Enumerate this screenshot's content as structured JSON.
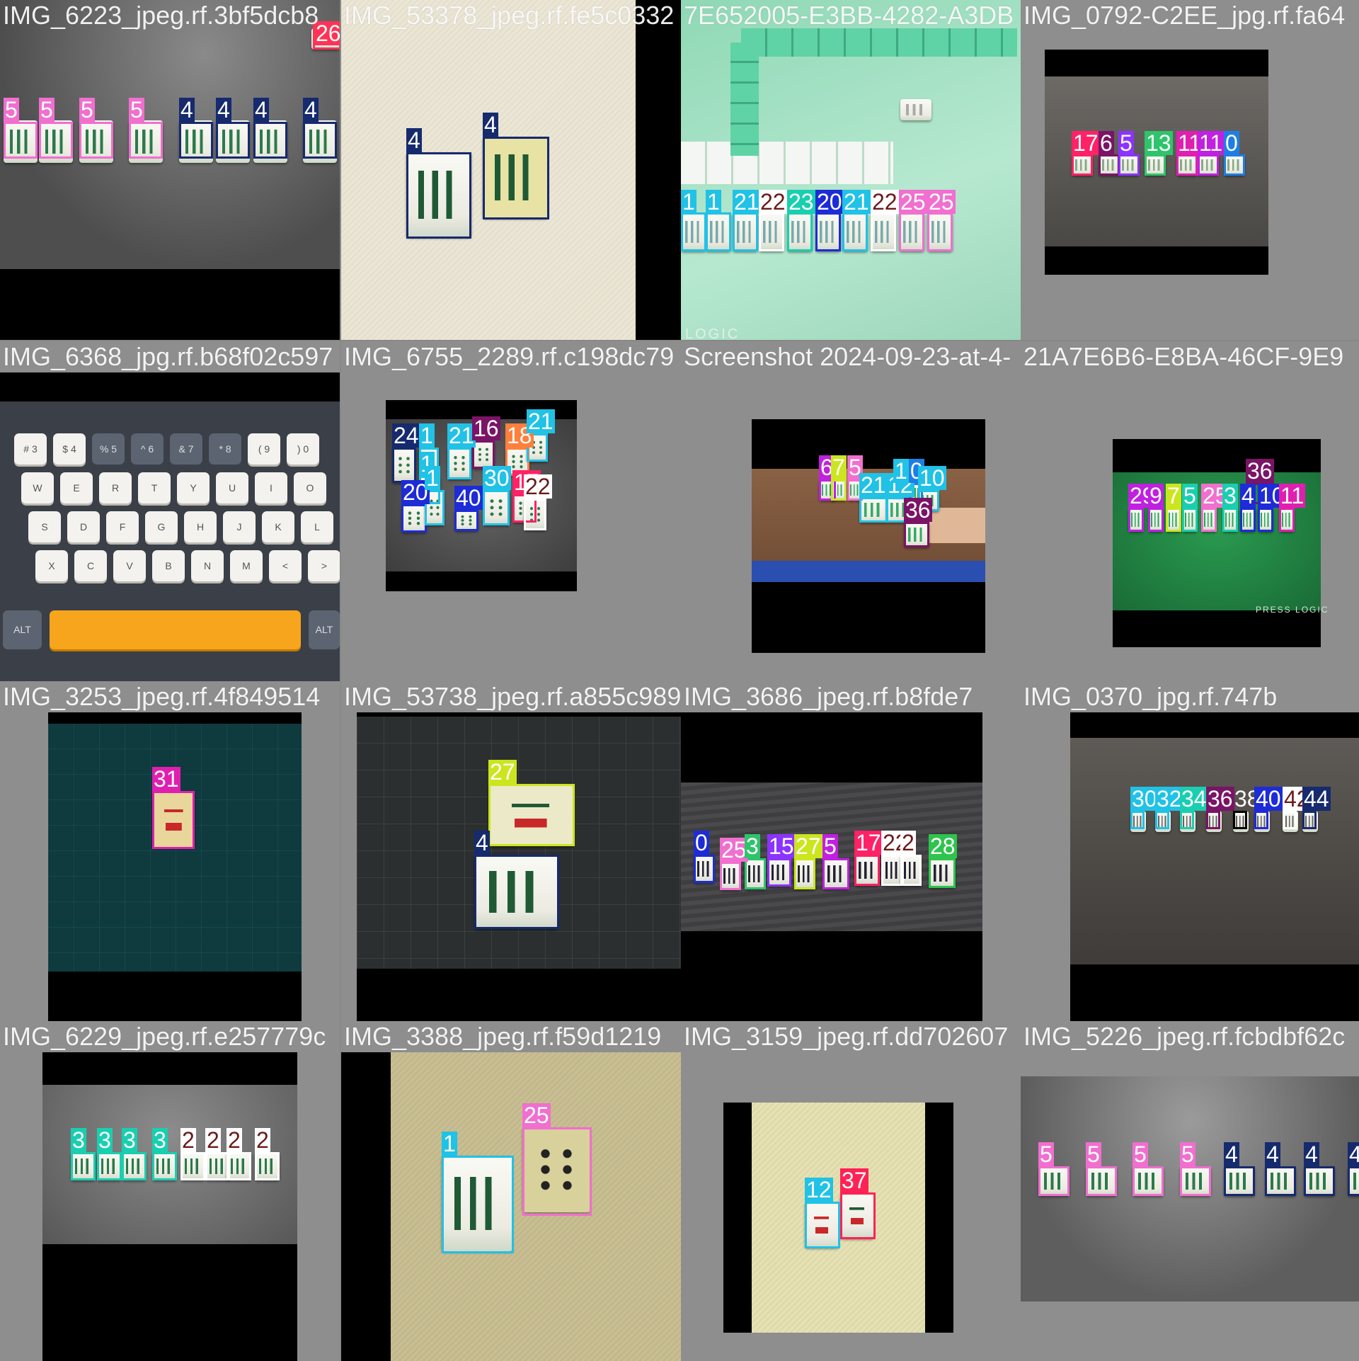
{
  "colors": {
    "c0": "#1d2cd6",
    "c1": "#20c2e6",
    "c2": "#20c2e6",
    "c3": "#19cfb0",
    "c4": "#162a6e",
    "c5": "#f06fcf",
    "c6": "#5b2b14",
    "c7": "#e6e6e6",
    "c8": "#ff8f3c",
    "c9": "#8c33ff",
    "c10": "#1e7ee6",
    "c11": "#c020e0",
    "c12": "#20c2e6",
    "c13": "#2ec46b",
    "c15": "#8c33ff",
    "c16": "#7a1466",
    "c17": "#ff2266",
    "c18": "#ff7f3c",
    "c20": "#1d2cd6",
    "c21": "#20c2e6",
    "c22": "#ffffff",
    "c23": "#19cfb0",
    "c24": "#162a6e",
    "c25": "#f06fcf",
    "c26": "#ff3355",
    "c27": "#cbe61e",
    "c28": "#2ec44d",
    "c29": "#c020e0",
    "c30": "#20c2e6",
    "c31": "#e01fb0",
    "c32": "#20c2e6",
    "c34": "#19cfb0",
    "c35": "#19cfb0",
    "c36": "#7a1466",
    "c37": "#ff2255",
    "c40": "#1d2cd6",
    "c42": "#ffffff",
    "c44": "#162a6e"
  },
  "cells": [
    {
      "title": "IMG_6223_jpeg.rf.3bf5dcb8"
    },
    {
      "title": "IMG_53378_jpeg.rf.fe5c0332"
    },
    {
      "title": "7E652005-E3BB-4282-A3DB"
    },
    {
      "title": "IMG_0792-C2EE_jpg.rf.fa64"
    },
    {
      "title": "IMG_6368_jpg.rf.b68f02c597"
    },
    {
      "title": "IMG_6755_2289.rf.c198dc79"
    },
    {
      "title": "Screenshot 2024-09-23-at-4-"
    },
    {
      "title": "21A7E6B6-E8BA-46CF-9E9"
    },
    {
      "title": "IMG_3253_jpeg.rf.4f849514"
    },
    {
      "title": "IMG_53738_jpeg.rf.a855c989"
    },
    {
      "title": "IMG_3686_jpeg.rf.b8fde7"
    },
    {
      "title": "IMG_0370_jpg.rf.747b"
    },
    {
      "title": "IMG_6229_jpeg.rf.e257779c"
    },
    {
      "title": "IMG_3388_jpeg.rf.f59d1219"
    },
    {
      "title": "IMG_3159_jpeg.rf.dd702607"
    },
    {
      "title": "IMG_5226_jpeg.rf.fcbdbf62c"
    }
  ],
  "labels": {
    "l26": "26",
    "l5": "5",
    "l4": "4",
    "l1": "1",
    "l21": "21",
    "l22": "22",
    "l23": "23",
    "l20": "20",
    "l25": "25",
    "l17": "17",
    "l6": "6",
    "l13": "13",
    "l11": "11",
    "l0": "0",
    "l24": "24",
    "l16": "16",
    "l18": "18",
    "l40": "40",
    "l30": "30",
    "l7": "7",
    "l12": "12",
    "l36": "36",
    "l29": "29",
    "l9": "9",
    "l3": "3",
    "l10": "10",
    "l31": "31",
    "l27": "27",
    "l15": "15",
    "l28": "28",
    "l32": "32",
    "l34": "34",
    "l38": "38",
    "l42": "42",
    "l44": "44",
    "l2": "2",
    "l37": "37"
  },
  "watermarks": {
    "w1": "LOGIC",
    "w2": "PRESS LOGIC"
  },
  "keyboard": {
    "row1": [
      "# 3",
      "$ 4",
      "% 5",
      "^ 6",
      "& 7",
      "* 8",
      "( 9",
      ") 0"
    ],
    "row2": [
      "W",
      "E",
      "R",
      "T",
      "Y",
      "U",
      "I",
      "O"
    ],
    "row3": [
      "S",
      "D",
      "F",
      "G",
      "H",
      "J",
      "K",
      "L"
    ],
    "row4": [
      "X",
      "C",
      "V",
      "B",
      "N",
      "M",
      "<",
      ">"
    ],
    "alt": "ALT"
  }
}
